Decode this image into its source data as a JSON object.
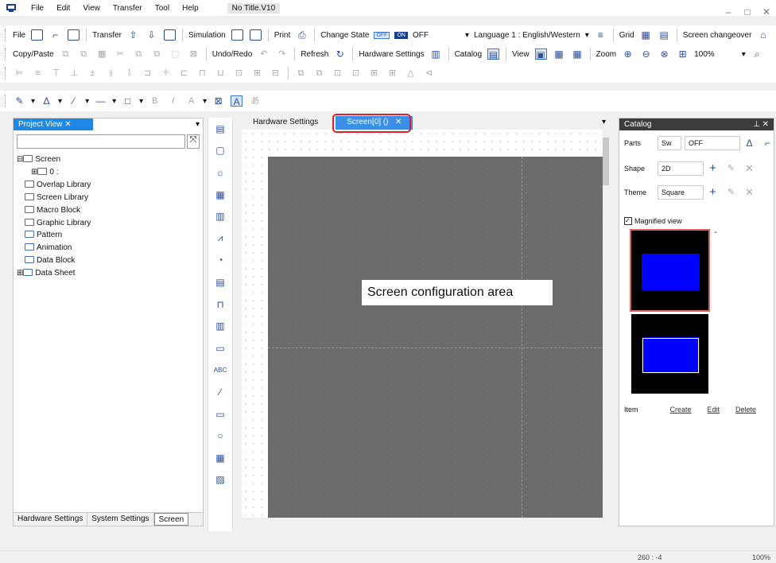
{
  "menu": {
    "items": [
      "File",
      "Edit",
      "View",
      "Transfer",
      "Tool",
      "Help"
    ],
    "doc_title": "No Title.V10"
  },
  "toolbar1": {
    "file": "File",
    "transfer": "Transfer",
    "simulation": "Simulation",
    "print": "Print",
    "change_state": "Change State",
    "chip_off": "OFF",
    "chip_on": "ON",
    "state_value": "OFF",
    "language": "Language 1 : English/Western",
    "grid": "Grid",
    "screen_changeover": "Screen changeover"
  },
  "toolbar2": {
    "copy_paste": "Copy/Paste",
    "undo_redo": "Undo/Redo",
    "refresh": "Refresh",
    "hardware_settings": "Hardware Settings",
    "catalog": "Catalog",
    "view": "View",
    "zoom": "Zoom",
    "zoom_value": "100%"
  },
  "project": {
    "title": "Project View",
    "items": [
      "Screen",
      "0 :",
      "Overlap Library",
      "Screen Library",
      "Macro Block",
      "Graphic Library",
      "Pattern",
      "Animation",
      "Data Block",
      "Data Sheet"
    ],
    "bottom_tabs": [
      "Hardware Settings",
      "System Settings",
      "Screen"
    ]
  },
  "editor": {
    "tabs": [
      "Hardware Settings",
      "Screen[0] ()"
    ],
    "annotation": "Screen configuration area"
  },
  "catalog": {
    "title": "Catalog",
    "parts_label": "Parts",
    "parts_sel": "Sw",
    "parts_state": "OFF",
    "shape_label": "Shape",
    "shape_val": "2D",
    "theme_label": "Theme",
    "theme_val": "Square",
    "magnified": "Magnified view",
    "item_label": "Item",
    "create": "Create",
    "edit": "Edit",
    "delete": "Delete"
  },
  "status": {
    "coords": "260 : -4",
    "zoom": "100%"
  },
  "colors": {
    "accent": "#1e88e5",
    "highlight": "#e02020",
    "part_fill": "#0000ff",
    "canvas": "#6b6b6b"
  }
}
